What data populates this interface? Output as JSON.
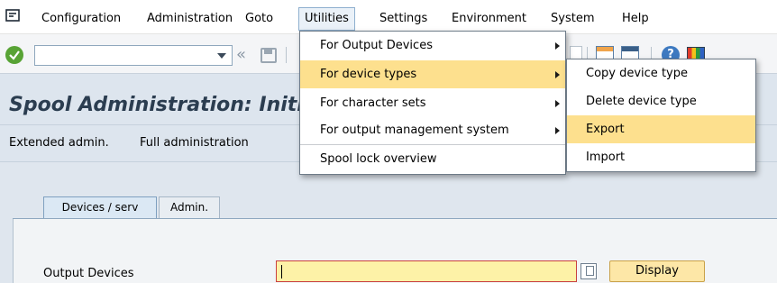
{
  "menubar": {
    "items": [
      {
        "label": "Configuration",
        "mnemonic": "C"
      },
      {
        "label": "Administration",
        "mnemonic": "A"
      },
      {
        "label": "Goto",
        "mnemonic": "G"
      },
      {
        "label": "Utilities",
        "mnemonic": "s"
      },
      {
        "label": "Settings",
        "mnemonic": "e"
      },
      {
        "label": "Environment",
        "mnemonic": "v"
      },
      {
        "label": "System",
        "mnemonic": "y"
      },
      {
        "label": "Help",
        "mnemonic": "H"
      }
    ]
  },
  "toolbar": {
    "command_value": "",
    "command_placeholder": ""
  },
  "page": {
    "title": "Spool Administration: Initia"
  },
  "appbar": {
    "extended_admin": "Extended admin.",
    "full_admin": "Full administration"
  },
  "tabs": [
    {
      "label": "Devices / serv",
      "selected": true
    },
    {
      "label": "Admin.",
      "selected": false
    }
  ],
  "form": {
    "output_devices_label": "Output Devices",
    "output_devices_value": "",
    "display_button": "Display"
  },
  "utilities_menu": {
    "items": [
      {
        "label": "For Output Devices",
        "has_submenu": true
      },
      {
        "label": "For device types",
        "has_submenu": true,
        "highlighted": true
      },
      {
        "label": "For character sets",
        "has_submenu": true
      },
      {
        "label": "For output management system",
        "has_submenu": true
      },
      {
        "label": "Spool lock overview",
        "has_submenu": false
      }
    ]
  },
  "device_types_submenu": {
    "items": [
      {
        "label": "Copy device type"
      },
      {
        "label": "Delete device type"
      },
      {
        "label": "Export",
        "highlighted": true
      },
      {
        "label": "Import"
      }
    ]
  },
  "colors": {
    "highlight": "#fde08e",
    "ok_green": "#58a335",
    "field_yellow": "#fdf2a7",
    "title_text": "#2b3d50"
  }
}
